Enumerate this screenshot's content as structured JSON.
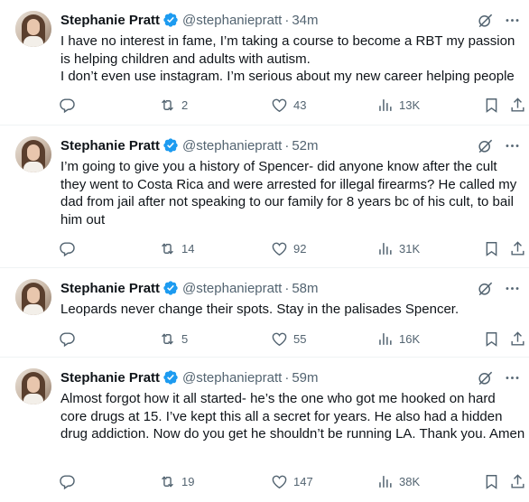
{
  "tweets": [
    {
      "name": "Stephanie Pratt",
      "handle": "@stephaniepratt",
      "time": "34m",
      "text": "I have no interest in fame, I’m taking a course to become a RBT my passion is helping children and adults with autism.\nI don’t even use instagram. I’m serious about my new career helping people",
      "replies": "",
      "retweets": "2",
      "likes": "43",
      "views": "13K"
    },
    {
      "name": "Stephanie Pratt",
      "handle": "@stephaniepratt",
      "time": "52m",
      "text": "I’m going to give you a history of Spencer- did anyone know after the cult they went to Costa Rica and were arrested for illegal firearms? He called my dad from jail after not speaking to our family for 8 years bc of his cult, to bail him out",
      "replies": "",
      "retweets": "14",
      "likes": "92",
      "views": "31K"
    },
    {
      "name": "Stephanie Pratt",
      "handle": "@stephaniepratt",
      "time": "58m",
      "text": "Leopards never change their spots. Stay in the palisades Spencer.",
      "replies": "",
      "retweets": "5",
      "likes": "55",
      "views": "16K"
    },
    {
      "name": "Stephanie Pratt",
      "handle": "@stephaniepratt",
      "time": "59m",
      "text": "Almost forgot how it all started- he’s the one who got me hooked on hard core drugs at 15. I’ve kept this all a secret for years. He also had a hidden drug addiction. Now do you get he shouldn’t be running LA. Thank you. Amen",
      "replies": "",
      "retweets": "19",
      "likes": "147",
      "views": "38K"
    }
  ],
  "separator": "·",
  "colors": {
    "verified": "#1d9bf0",
    "muted": "#536471",
    "text": "#0f1419",
    "divider": "#eff3f4"
  }
}
